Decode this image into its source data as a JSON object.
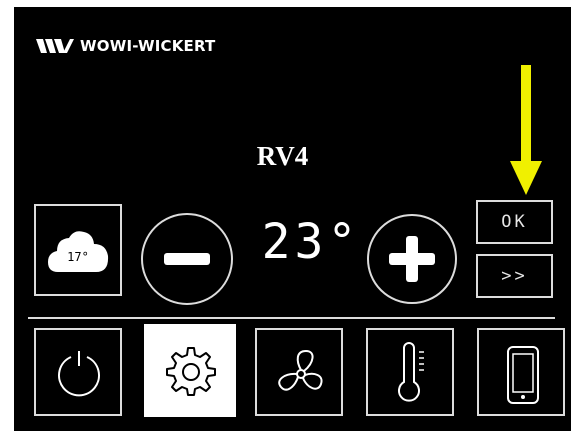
{
  "brand": {
    "name": "WOWI-WICKERT",
    "logo_icon": "wowi-wickert-logo-icon"
  },
  "device": {
    "title": "RV4"
  },
  "weather": {
    "outside_temp": "17°",
    "icon": "cloud-icon"
  },
  "thermostat": {
    "setpoint": "23°",
    "decrease_icon": "minus-icon",
    "increase_icon": "plus-icon"
  },
  "buttons": {
    "ok_label": "OK",
    "next_label": ">>"
  },
  "menu": [
    {
      "id": "power",
      "icon": "power-icon",
      "selected": false
    },
    {
      "id": "settings",
      "icon": "gear-icon",
      "selected": true
    },
    {
      "id": "fan",
      "icon": "fan-icon",
      "selected": false
    },
    {
      "id": "temperature",
      "icon": "thermometer-icon",
      "selected": false
    },
    {
      "id": "device",
      "icon": "smartphone-icon",
      "selected": false
    }
  ],
  "colors": {
    "background": "#000000",
    "outline": "#dcdcdc",
    "selected_bg": "#ffffff",
    "annotation_arrow": "#f0f000"
  }
}
